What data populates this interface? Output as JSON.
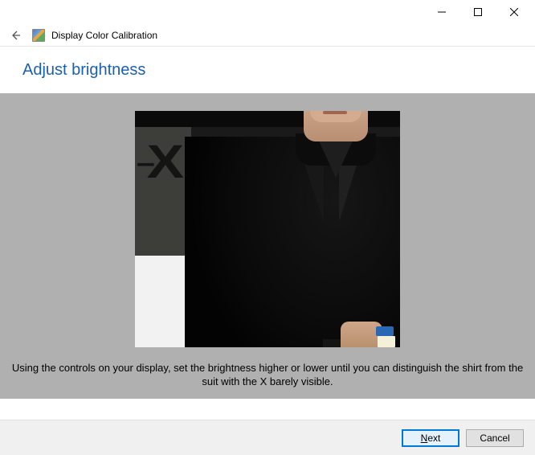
{
  "window": {
    "title": "Display Color Calibration"
  },
  "page": {
    "heading": "Adjust brightness",
    "instruction": "Using the controls on your display, set the brightness higher or lower until you can distinguish the shirt from the suit with the X barely visible."
  },
  "buttons": {
    "next_prefix": "N",
    "next_rest": "ext",
    "cancel": "Cancel"
  }
}
